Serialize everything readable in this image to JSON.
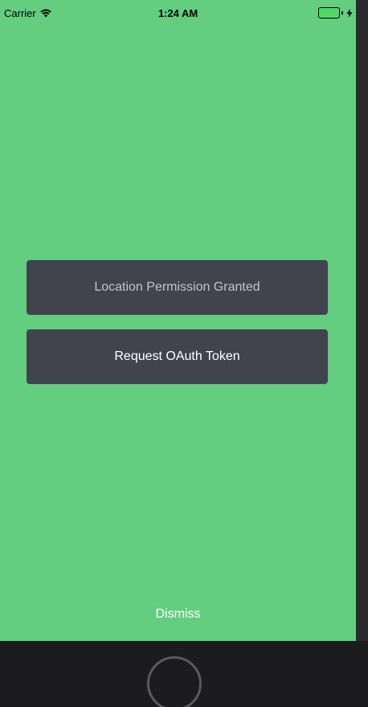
{
  "status_bar": {
    "carrier": "Carrier",
    "time": "1:24 AM",
    "wifi_icon": "wifi-icon",
    "battery_icon": "battery-icon",
    "charging_icon": "charging-bolt-icon"
  },
  "main": {
    "location_button_label": "Location Permission Granted",
    "oauth_button_label": "Request OAuth Token",
    "dismiss_label": "Dismiss"
  },
  "colors": {
    "background": "#63cd80",
    "button_bg": "#41444f",
    "disabled_text": "#c2c4c9",
    "text": "#ffffff"
  },
  "device": {
    "home_button_icon": "home-button-icon"
  }
}
